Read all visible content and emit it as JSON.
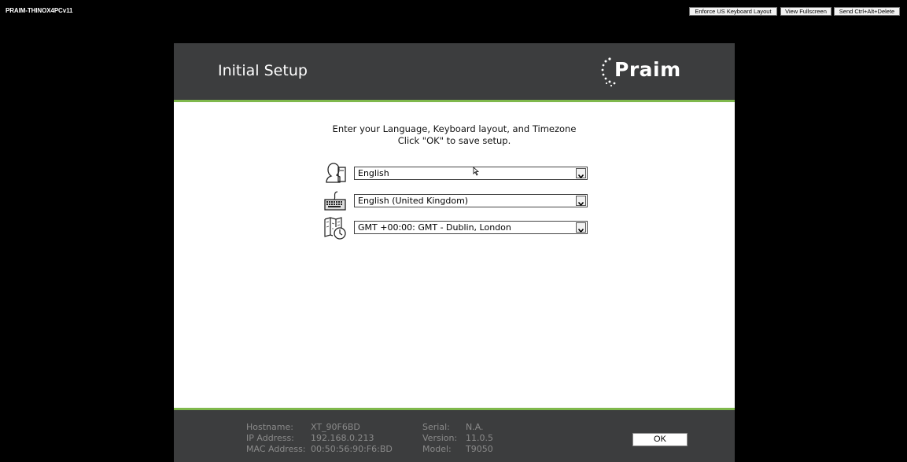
{
  "session": {
    "machine_name": "PRAIM-THINOX4PCv11",
    "buttons": {
      "enforce_keyboard": "Enforce US Keyboard Layout",
      "fullscreen": "View Fullscreen",
      "ctrl_alt_del": "Send Ctrl+Alt+Delete"
    }
  },
  "header": {
    "title": "Initial Setup",
    "logo_text": "Praim"
  },
  "instructions": {
    "line1": "Enter your Language, Keyboard layout, and Timezone",
    "line2": "Click \"OK\" to save setup."
  },
  "settings": {
    "language": {
      "value": "English",
      "icon": "language-head-icon"
    },
    "keyboard": {
      "value": "English (United Kingdom)",
      "icon": "keyboard-icon"
    },
    "timezone": {
      "value": "GMT +00:00: GMT - Dublin, London",
      "icon": "map-clock-icon"
    }
  },
  "device_info": {
    "hostname_label": "Hostname:",
    "hostname": "XT_90F6BD",
    "ip_label": "IP Address:",
    "ip": "192.168.0.213",
    "mac_label": "MAC Address:",
    "mac": "00:50:56:90:F6:BD",
    "serial_label": "Serial:",
    "serial": "N.A.",
    "version_label": "Version:",
    "version": "11.0.5",
    "model_label": "Model:",
    "model": "T9050"
  },
  "ok_label": "OK",
  "colors": {
    "header_bg": "#3c3d3e",
    "accent_green": "#7fb84c",
    "info_text": "#8a8a8a"
  }
}
